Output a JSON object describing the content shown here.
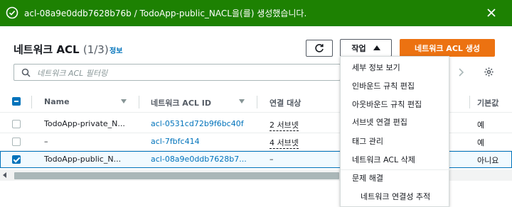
{
  "flash": {
    "message": "acl-08a9e0ddb7628b76b / TodoApp-public_NACL을(를) 생성했습니다.",
    "status_color": "#1d8102"
  },
  "header": {
    "title": "네트워크 ACL",
    "count": "(1/3)",
    "info_link": "정보",
    "actions_label": "작업",
    "create_label": "네트워크 ACL 생성",
    "create_color": "#ec7211"
  },
  "search": {
    "placeholder": "네트워크 ACL 필터링"
  },
  "table": {
    "columns": [
      "Name",
      "네트워크 ACL ID",
      "연결 대상",
      "기본값"
    ],
    "rows": [
      {
        "name": "TodoApp-private_N...",
        "id": "acl-0531cd72b9f6bc40f",
        "assoc": "2 서브넷",
        "default": "예",
        "checked": false
      },
      {
        "name": "–",
        "id": "acl-7fbfc414",
        "assoc": "4 서브넷",
        "default": "예",
        "checked": false
      },
      {
        "name": "TodoApp-public_N...",
        "id": "acl-08a9e0ddb7628b7...",
        "assoc": "–",
        "default": "아니요",
        "checked": true
      }
    ]
  },
  "actions_menu": {
    "items": [
      "세부 정보 보기",
      "인바운드 규칙 편집",
      "아웃바운드 규칙 편집",
      "서브넷 연결 편집",
      "태그 관리",
      "네트워크 ACL 삭제"
    ],
    "group_label": "문제 해결",
    "sub_item": "네트워크 연결성 추적"
  }
}
